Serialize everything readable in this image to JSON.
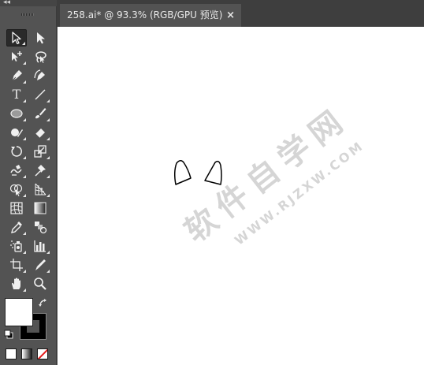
{
  "toolbar": {
    "collapse_label": "◂◂",
    "tools": [
      {
        "name": "selection-tool-icon",
        "active": true
      },
      {
        "name": "direct-selection-tool-icon"
      },
      {
        "name": "magic-wand-tool-icon"
      },
      {
        "name": "lasso-tool-icon"
      },
      {
        "name": "pen-tool-icon"
      },
      {
        "name": "curvature-tool-icon"
      },
      {
        "name": "type-tool-icon",
        "glyph": "T"
      },
      {
        "name": "line-segment-tool-icon"
      },
      {
        "name": "ellipse-tool-icon"
      },
      {
        "name": "paintbrush-tool-icon"
      },
      {
        "name": "shaper-tool-icon"
      },
      {
        "name": "eraser-tool-icon"
      },
      {
        "name": "rotate-tool-icon"
      },
      {
        "name": "scale-tool-icon"
      },
      {
        "name": "warp-tool-icon"
      },
      {
        "name": "puppet-warp-tool-icon"
      },
      {
        "name": "shape-builder-tool-icon"
      },
      {
        "name": "perspective-grid-tool-icon"
      },
      {
        "name": "mesh-tool-icon"
      },
      {
        "name": "gradient-tool-icon"
      },
      {
        "name": "eyedropper-tool-icon"
      },
      {
        "name": "blend-tool-icon"
      },
      {
        "name": "symbol-sprayer-tool-icon"
      },
      {
        "name": "column-graph-tool-icon"
      },
      {
        "name": "artboard-tool-icon"
      },
      {
        "name": "slice-tool-icon"
      },
      {
        "name": "hand-tool-icon"
      },
      {
        "name": "zoom-tool-icon"
      }
    ],
    "fill_color": "#ffffff",
    "stroke_color": "#000000",
    "none_color": "#e51b1b"
  },
  "document": {
    "tab_title": "258.ai* @ 93.3% (RGB/GPU 预览)",
    "close_glyph": "×"
  },
  "watermark": {
    "line1": "软件自学网",
    "line2": "WWW.RJZXW.COM"
  },
  "colors": {
    "app_bg": "#535353",
    "tab_bar_bg": "#3e3e3e",
    "canvas_bg": "#ffffff",
    "artwork_stroke": "#000000"
  }
}
